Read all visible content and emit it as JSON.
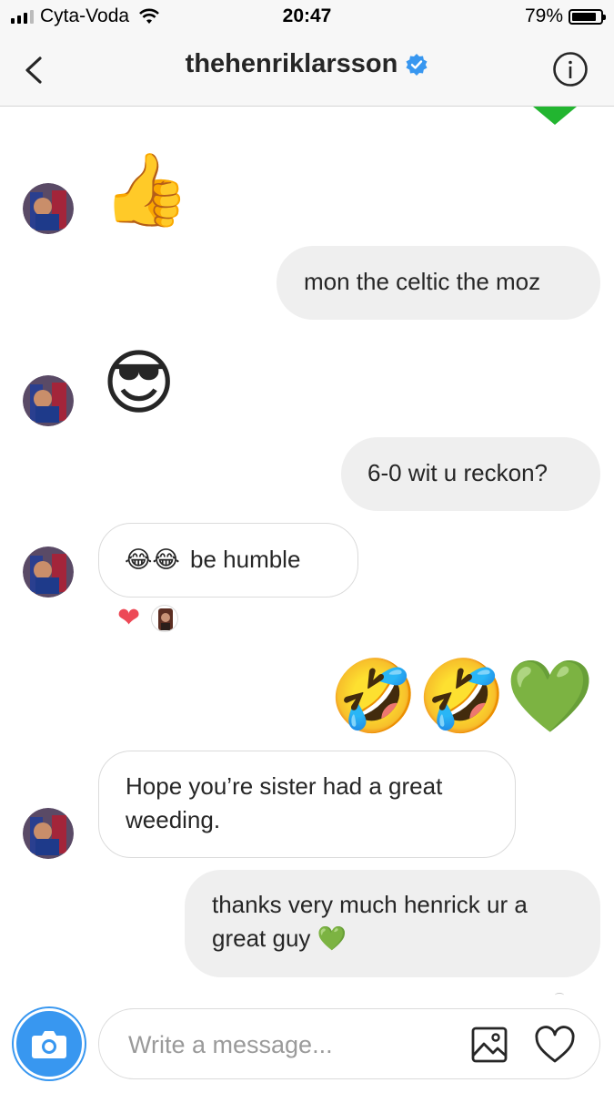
{
  "status_bar": {
    "carrier": "Cyta-Voda",
    "time": "20:47",
    "battery": "79%"
  },
  "header": {
    "username": "thehenriklarsson",
    "verified": true
  },
  "messages": [
    {
      "from": "them",
      "type": "emoji",
      "text": "👍"
    },
    {
      "from": "me",
      "type": "text",
      "text": "mon the celtic the moz"
    },
    {
      "from": "them",
      "type": "emoji",
      "text": "😎"
    },
    {
      "from": "me",
      "type": "text",
      "text": "6-0 wit u reckon?"
    },
    {
      "from": "them",
      "type": "text",
      "text": "😂😂 be humble",
      "emoji_prefix": "😂😂",
      "body": "be humble",
      "reaction": "❤"
    },
    {
      "from": "me",
      "type": "emoji",
      "text": "🤣🤣💚"
    },
    {
      "from": "them",
      "type": "text",
      "line1": "Hope you’re sister had a great",
      "line2": "weeding."
    },
    {
      "from": "me",
      "type": "text",
      "line1": "thanks very much henrick ur a",
      "line2": "great guy 💚"
    }
  ],
  "composer": {
    "placeholder": "Write a message..."
  },
  "colors": {
    "accent": "#3897f0",
    "bubble_out": "#efefef",
    "heart": "#ed4956",
    "green_heart": "#2fcc3a"
  },
  "icons": [
    "back-chevron-icon",
    "verified-badge-icon",
    "info-icon",
    "camera-icon",
    "gallery-icon",
    "heart-outline-icon"
  ]
}
